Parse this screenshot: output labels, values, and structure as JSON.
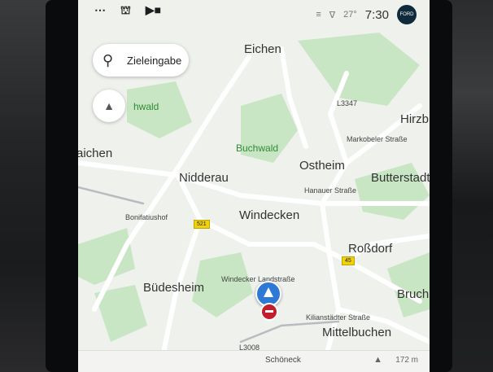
{
  "status": {
    "left_icons": [
      "grid-dots-icon",
      "car-icon",
      "media-icon"
    ],
    "temperature": "27°",
    "time": "7:30",
    "profile_badge": "FORD"
  },
  "search": {
    "label": "Zieleingabe"
  },
  "map": {
    "towns": [
      "Eichen",
      "Nidderau",
      "Ostheim",
      "Windecken",
      "Büdesheim",
      "Roßdorf",
      "Butterstadt",
      "Bruch",
      "Mittelbuchen",
      "aichen",
      "Hirzb"
    ],
    "forests": [
      "Buchwald",
      "hwald"
    ],
    "streets": [
      "Markobeler Straße",
      "Hanauer Straße",
      "Bonifatiushof",
      "Windecker Landstraße",
      "Kilianstädter Straße",
      "L3347",
      "L3008"
    ],
    "road_badges": [
      "521",
      "45"
    ]
  },
  "bottom": {
    "street": "Schöneck",
    "distance": "172 m"
  }
}
